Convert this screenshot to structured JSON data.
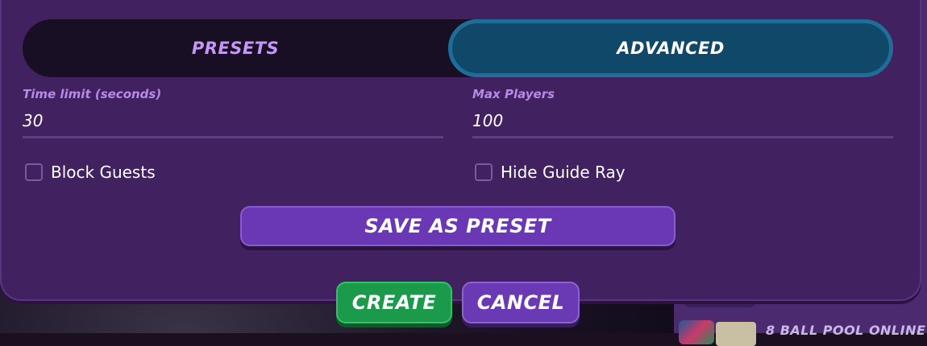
{
  "tabs": {
    "presets_label": "PRESETS",
    "advanced_label": "ADVANCED",
    "active": "ADVANCED"
  },
  "fields": {
    "time_limit": {
      "label": "Time limit (seconds)",
      "value": "30"
    },
    "max_players": {
      "label": "Max Players",
      "value": "100"
    }
  },
  "options": {
    "block_guests": {
      "label": "Block Guests",
      "checked": false
    },
    "hide_guide_ray": {
      "label": "Hide Guide Ray",
      "checked": false
    }
  },
  "buttons": {
    "save_preset": "SAVE AS PRESET",
    "create": "CREATE",
    "cancel": "CANCEL"
  },
  "background": {
    "game_label": "8 BALL POOL ONLINE"
  },
  "colors": {
    "dialog_bg": "#41215f",
    "tab_active_bg": "#0f4868",
    "tab_active_border": "#1f6e9a",
    "tab_inactive_text": "#c697f2",
    "accent_purple": "#6a38b4",
    "create_green": "#1a9a4a"
  }
}
